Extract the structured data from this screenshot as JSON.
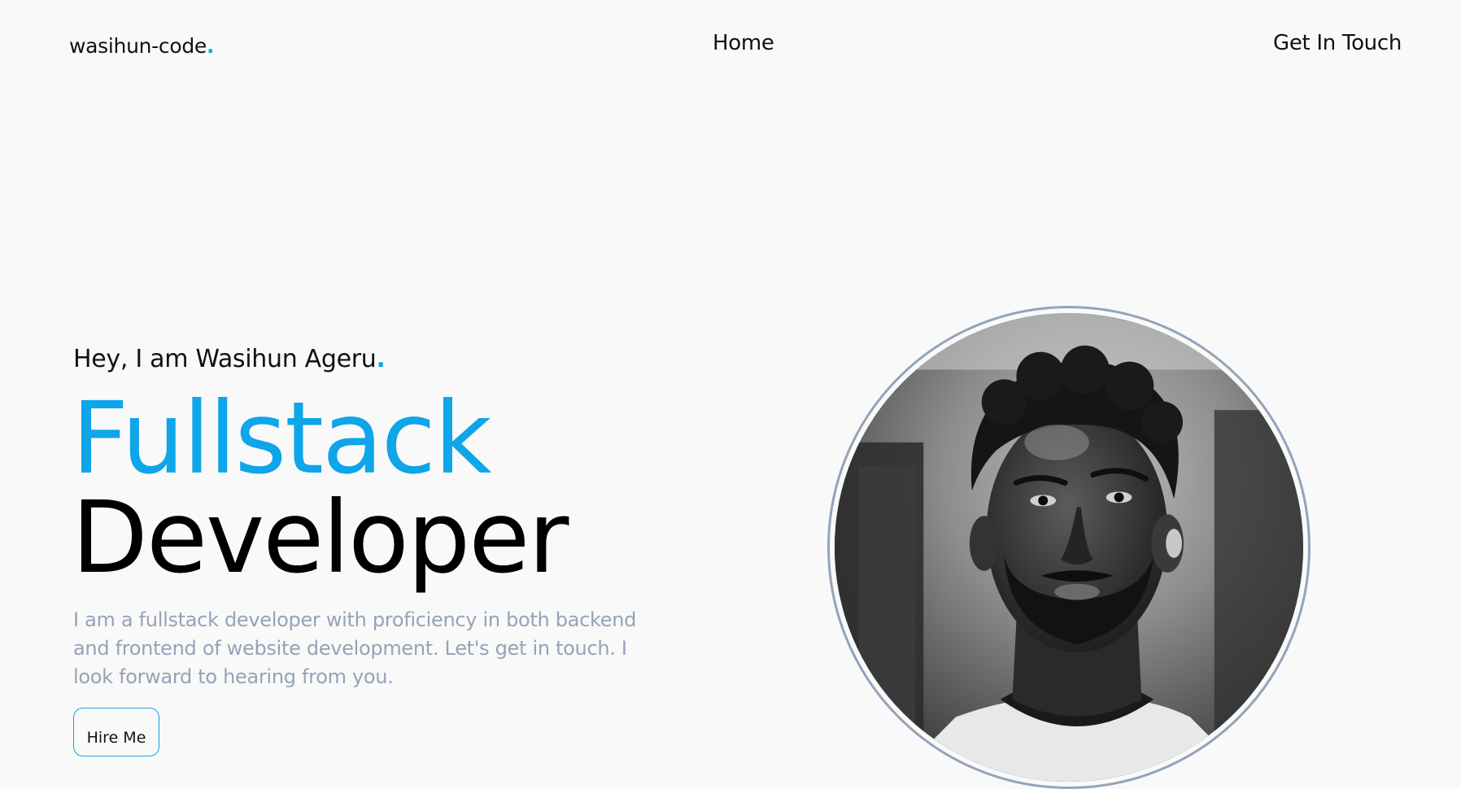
{
  "nav": {
    "logo_text": "wasihun-code",
    "logo_dot": ".",
    "home_label": "Home",
    "contact_label": "Get In Touch"
  },
  "hero": {
    "greeting": "Hey, I am Wasihun Ageru",
    "greeting_dot": ".",
    "headline_line1": "Fullstack",
    "headline_line2": "Developer",
    "bio": "I am a fullstack developer with proficiency in both backend and frontend of website development. Let's get in touch. I look forward to hearing from you.",
    "cta_label": "Hire Me"
  },
  "colors": {
    "accent": "#0ea5e9",
    "muted_text": "#94a3b8",
    "background": "#f9f9f9",
    "text": "#111111"
  },
  "profile_photo": {
    "style": "grayscale portrait",
    "icon": "profile-photo"
  }
}
